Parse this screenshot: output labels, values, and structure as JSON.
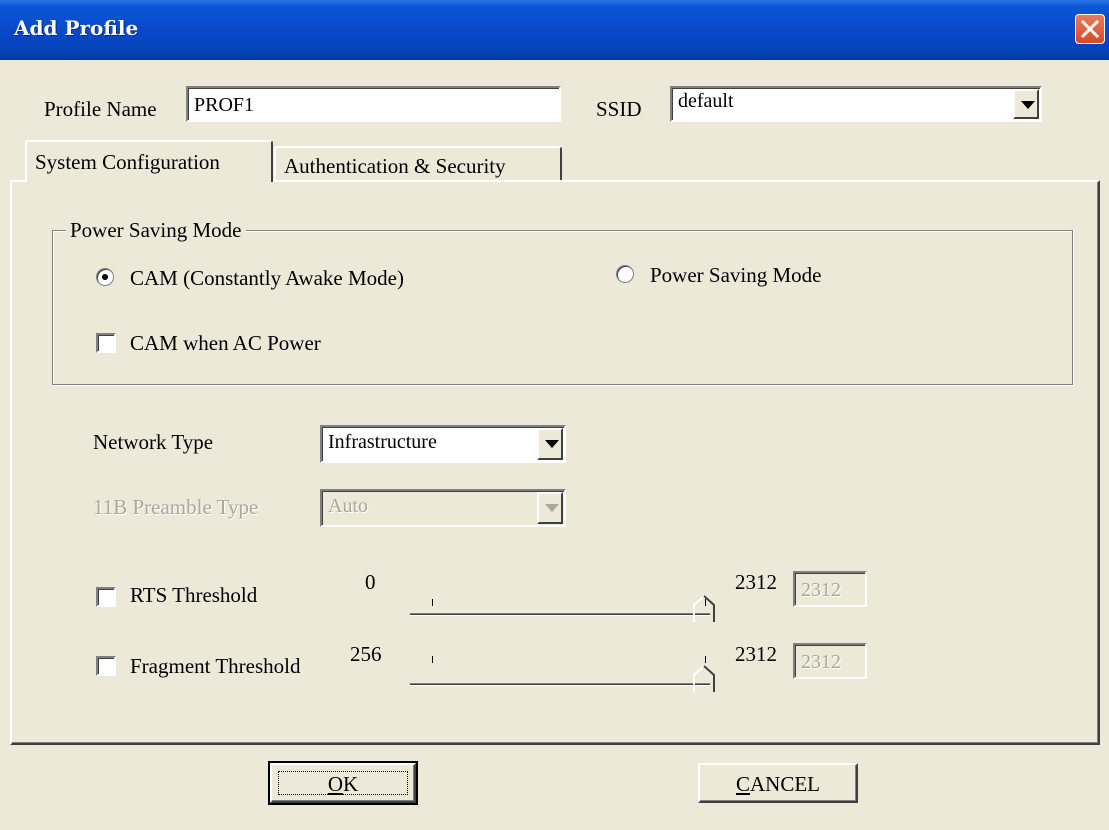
{
  "window": {
    "title": "Add Profile"
  },
  "profile": {
    "name_label": "Profile Name",
    "name_value": "PROF1",
    "ssid_label": "SSID",
    "ssid_value": "default"
  },
  "tabs": [
    {
      "label": "System Configuration",
      "active": true
    },
    {
      "label": "Authentication & Security",
      "active": false
    }
  ],
  "power_saving": {
    "group_title": "Power Saving Mode",
    "cam_label": "CAM (Constantly Awake Mode)",
    "psm_label": "Power Saving Mode",
    "selected": "cam",
    "cam_ac_label": "CAM when AC Power",
    "cam_ac_checked": false
  },
  "network": {
    "type_label": "Network Type",
    "type_value": "Infrastructure",
    "preamble_label": "11B Preamble Type",
    "preamble_value": "Auto",
    "preamble_enabled": false
  },
  "rts": {
    "label": "RTS Threshold",
    "checked": false,
    "min": "0",
    "max": "2312",
    "value": "2312"
  },
  "fragment": {
    "label": "Fragment Threshold",
    "checked": false,
    "min": "256",
    "max": "2312",
    "value": "2312"
  },
  "buttons": {
    "ok": "OK",
    "cancel": "CANCEL"
  }
}
